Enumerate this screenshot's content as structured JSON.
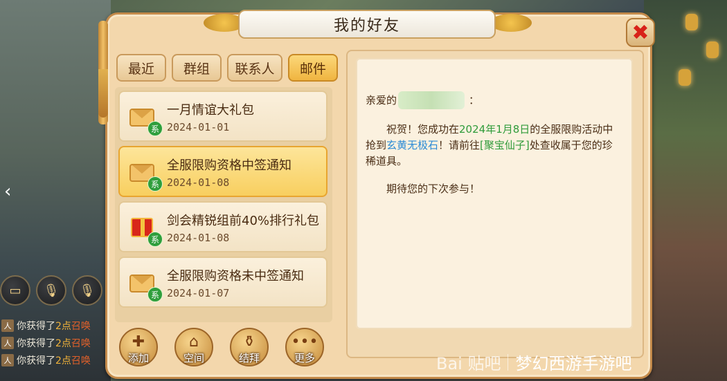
{
  "window": {
    "title": "我的好友",
    "close_symbol": "✖"
  },
  "tabs": [
    {
      "label": "最近",
      "active": false
    },
    {
      "label": "群组",
      "active": false
    },
    {
      "label": "联系人",
      "active": false
    },
    {
      "label": "邮件",
      "active": true
    }
  ],
  "mails": [
    {
      "icon": "envelope-icon",
      "title": "一月情谊大礼包",
      "date": "2024-01-01",
      "badge": "系",
      "selected": false
    },
    {
      "icon": "envelope-icon",
      "title": "全服限购资格中签通知",
      "date": "2024-01-08",
      "badge": "系",
      "selected": true
    },
    {
      "icon": "gift-box-icon",
      "title": "剑会精锐组前40%排行礼包",
      "date": "2024-01-08",
      "badge": "系",
      "selected": false
    },
    {
      "icon": "envelope-icon",
      "title": "全服限购资格未中签通知",
      "date": "2024-01-07",
      "badge": "系",
      "selected": false
    }
  ],
  "letter": {
    "salutation_prefix": "亲爱的",
    "salutation_suffix": "：",
    "p1_a": "祝贺！您成功在",
    "p1_date": "2024年1月8日",
    "p1_b": "的全服限购活动中抢到",
    "p1_item": "玄黄无极石",
    "p1_c": "！请前往",
    "p1_npc": "[聚宝仙子]",
    "p1_d": "处查收属于您的珍稀道具。",
    "closing": "期待您的下次参与！"
  },
  "bottom_buttons": [
    {
      "label": "添加",
      "icon": "add-friend-icon",
      "glyph": "✚"
    },
    {
      "label": "空间",
      "icon": "house-icon",
      "glyph": "⌂"
    },
    {
      "label": "结拜",
      "icon": "jar-icon",
      "glyph": "⚱"
    },
    {
      "label": "更多",
      "icon": "more-dots-icon",
      "glyph": "•••"
    }
  ],
  "chat": [
    {
      "tag": "人",
      "text": "你获得了",
      "hl": "2点",
      "hl2": "召唤"
    },
    {
      "tag": "人",
      "text": "你获得了",
      "hl": "2点",
      "hl2": "召唤"
    },
    {
      "tag": "人",
      "text": "你获得了",
      "hl": "2点",
      "hl2": "召唤"
    }
  ],
  "watermark": {
    "brand": "Bai 贴吧",
    "forum": "梦幻西游手游吧"
  },
  "colors": {
    "active_tab": "#f0b540",
    "selected_mail": "#f8cf5f",
    "green_text": "#2f9b3a",
    "blue_text": "#2a8bd6",
    "close_red": "#d8231a"
  }
}
